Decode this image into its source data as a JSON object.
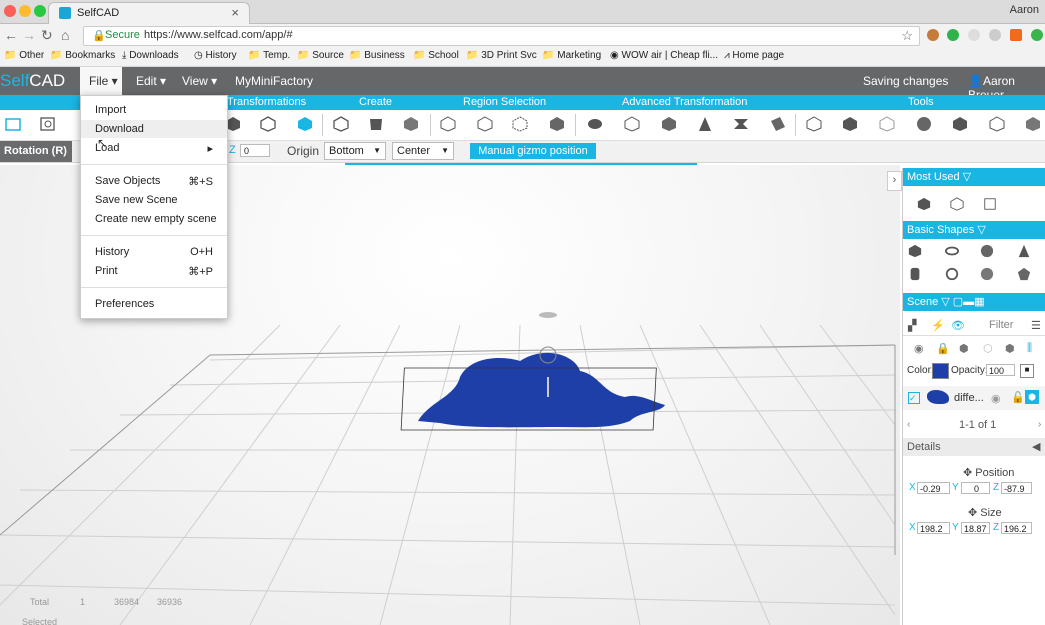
{
  "browser": {
    "tab_title": "SelfCAD",
    "tab_close": "×",
    "profile": "Aaron",
    "secure_label": "Secure",
    "url": "https://www.selfcad.com/app/#",
    "bookmarks": [
      "Other",
      "Bookmarks",
      "Downloads",
      "History",
      "Temp.",
      "Source",
      "Business",
      "School",
      "3D Print Svc",
      "Marketing",
      "WOW air | Cheap fli...",
      "Home page"
    ]
  },
  "app": {
    "logo_self": "Self",
    "logo_cad": "CAD",
    "menus": [
      "File ▾",
      "Edit ▾",
      "View ▾",
      "MyMiniFactory"
    ],
    "status": "Saving changes",
    "user": "Aaron Breuer"
  },
  "categories": [
    "Transformations",
    "Create",
    "Region Selection",
    "Advanced Transformation",
    "Tools"
  ],
  "subbar": {
    "mode": "Rotation (R)",
    "z_label": "Z",
    "z_value": "0",
    "origin_label": "Origin",
    "origin_value": "Bottom",
    "origin_value2": "Center",
    "gizmo_label": "Manual gizmo position"
  },
  "file_menu": {
    "items": [
      {
        "label": "Import",
        "shortcut": ""
      },
      {
        "label": "Download",
        "shortcut": ""
      },
      {
        "label": "Load",
        "shortcut": "▸"
      },
      {
        "label": "Save Objects",
        "shortcut": "⌘+S"
      },
      {
        "label": "Save new Scene",
        "shortcut": ""
      },
      {
        "label": "Create new empty scene",
        "shortcut": ""
      },
      {
        "label": "History",
        "shortcut": "O+H"
      },
      {
        "label": "Print",
        "shortcut": "⌘+P"
      },
      {
        "label": "Preferences",
        "shortcut": ""
      }
    ]
  },
  "right_panel": {
    "most_used": "Most Used",
    "basic_shapes": "Basic Shapes",
    "scene": "Scene",
    "filter": "Filter",
    "color_label": "Color:",
    "color_value": "#1f3fa8",
    "opacity_label": "Opacity:",
    "opacity_value": "100",
    "object_name": "diffe...",
    "pagination": "1-1 of 1",
    "details": "Details",
    "position_label": "Position",
    "position": {
      "x": "-0.29",
      "y": "0",
      "z": "-87.9"
    },
    "size_label": "Size",
    "size": {
      "x": "198.2",
      "y": "18.87",
      "z": "196.2"
    }
  },
  "stats": {
    "total_label": "Total",
    "total_values": [
      "1",
      "36984",
      "36936"
    ],
    "selected_label": "Selected"
  },
  "colors": {
    "accent": "#19b5e3",
    "header": "#666769",
    "model": "#1f3fa8"
  }
}
